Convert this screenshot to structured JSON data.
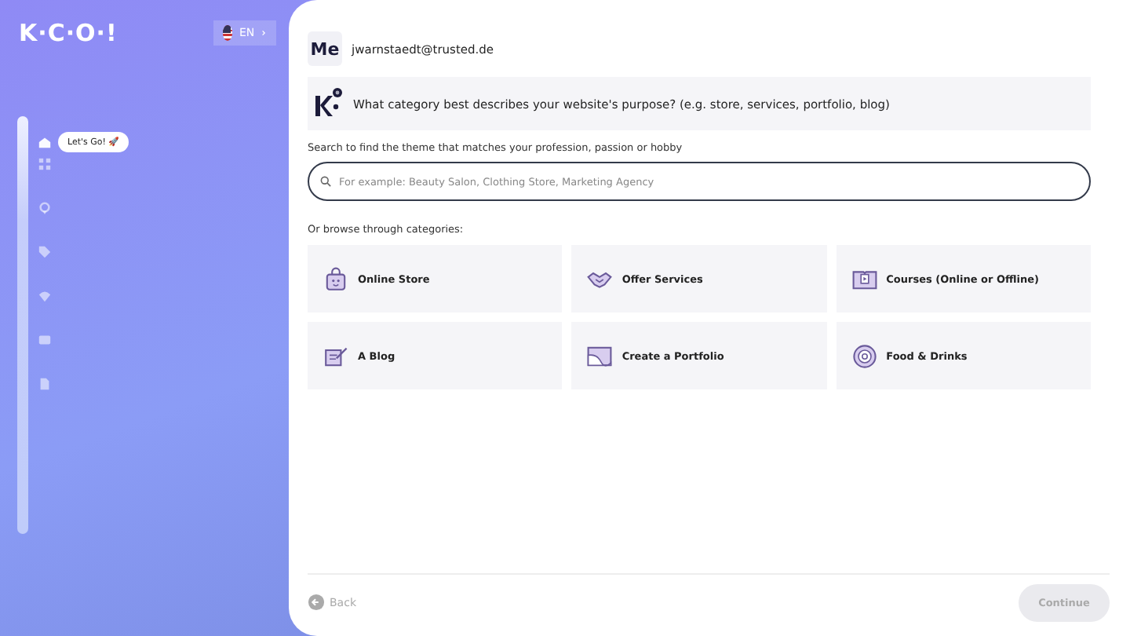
{
  "sidebar": {
    "logo": "K·C·O·!",
    "language": {
      "label": "EN"
    },
    "steps": [
      {
        "selected": true,
        "tooltip": "Let's Go! 🚀"
      },
      {
        "selected": false
      },
      {
        "selected": false
      },
      {
        "selected": false
      },
      {
        "selected": false
      },
      {
        "selected": false
      },
      {
        "selected": false
      }
    ]
  },
  "chat": {
    "user": {
      "avatar": "Me",
      "email": "jwarnstaedt@trusted.de"
    },
    "question": "What category best describes your website's purpose? (e.g. store, services, portfolio, blog)"
  },
  "search": {
    "label": "Search to find the theme that matches your profession, passion or hobby",
    "placeholder": "For example: Beauty Salon, Clothing Store, Marketing Agency"
  },
  "browse_label": "Or browse through categories:",
  "categories": [
    {
      "label": "Online Store"
    },
    {
      "label": "Offer Services"
    },
    {
      "label": "Courses (Online or Offline)"
    },
    {
      "label": "A Blog"
    },
    {
      "label": "Create a Portfolio"
    },
    {
      "label": "Food & Drinks"
    }
  ],
  "footer": {
    "back": {
      "label": "Back",
      "disabled": true
    },
    "continue": {
      "label": "Continue",
      "disabled": true
    }
  }
}
